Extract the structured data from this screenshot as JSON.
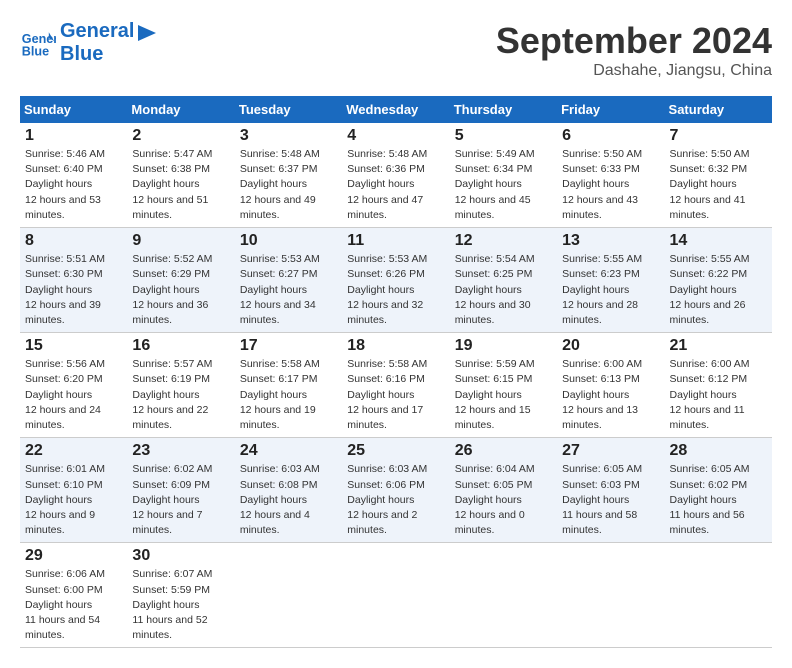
{
  "header": {
    "logo_line1": "General",
    "logo_line2": "Blue",
    "month_title": "September 2024",
    "location": "Dashahe, Jiangsu, China"
  },
  "weekdays": [
    "Sunday",
    "Monday",
    "Tuesday",
    "Wednesday",
    "Thursday",
    "Friday",
    "Saturday"
  ],
  "weeks": [
    [
      {
        "day": "1",
        "sunrise": "5:46 AM",
        "sunset": "6:40 PM",
        "daylight": "12 hours and 53 minutes."
      },
      {
        "day": "2",
        "sunrise": "5:47 AM",
        "sunset": "6:38 PM",
        "daylight": "12 hours and 51 minutes."
      },
      {
        "day": "3",
        "sunrise": "5:48 AM",
        "sunset": "6:37 PM",
        "daylight": "12 hours and 49 minutes."
      },
      {
        "day": "4",
        "sunrise": "5:48 AM",
        "sunset": "6:36 PM",
        "daylight": "12 hours and 47 minutes."
      },
      {
        "day": "5",
        "sunrise": "5:49 AM",
        "sunset": "6:34 PM",
        "daylight": "12 hours and 45 minutes."
      },
      {
        "day": "6",
        "sunrise": "5:50 AM",
        "sunset": "6:33 PM",
        "daylight": "12 hours and 43 minutes."
      },
      {
        "day": "7",
        "sunrise": "5:50 AM",
        "sunset": "6:32 PM",
        "daylight": "12 hours and 41 minutes."
      }
    ],
    [
      {
        "day": "8",
        "sunrise": "5:51 AM",
        "sunset": "6:30 PM",
        "daylight": "12 hours and 39 minutes."
      },
      {
        "day": "9",
        "sunrise": "5:52 AM",
        "sunset": "6:29 PM",
        "daylight": "12 hours and 36 minutes."
      },
      {
        "day": "10",
        "sunrise": "5:53 AM",
        "sunset": "6:27 PM",
        "daylight": "12 hours and 34 minutes."
      },
      {
        "day": "11",
        "sunrise": "5:53 AM",
        "sunset": "6:26 PM",
        "daylight": "12 hours and 32 minutes."
      },
      {
        "day": "12",
        "sunrise": "5:54 AM",
        "sunset": "6:25 PM",
        "daylight": "12 hours and 30 minutes."
      },
      {
        "day": "13",
        "sunrise": "5:55 AM",
        "sunset": "6:23 PM",
        "daylight": "12 hours and 28 minutes."
      },
      {
        "day": "14",
        "sunrise": "5:55 AM",
        "sunset": "6:22 PM",
        "daylight": "12 hours and 26 minutes."
      }
    ],
    [
      {
        "day": "15",
        "sunrise": "5:56 AM",
        "sunset": "6:20 PM",
        "daylight": "12 hours and 24 minutes."
      },
      {
        "day": "16",
        "sunrise": "5:57 AM",
        "sunset": "6:19 PM",
        "daylight": "12 hours and 22 minutes."
      },
      {
        "day": "17",
        "sunrise": "5:58 AM",
        "sunset": "6:17 PM",
        "daylight": "12 hours and 19 minutes."
      },
      {
        "day": "18",
        "sunrise": "5:58 AM",
        "sunset": "6:16 PM",
        "daylight": "12 hours and 17 minutes."
      },
      {
        "day": "19",
        "sunrise": "5:59 AM",
        "sunset": "6:15 PM",
        "daylight": "12 hours and 15 minutes."
      },
      {
        "day": "20",
        "sunrise": "6:00 AM",
        "sunset": "6:13 PM",
        "daylight": "12 hours and 13 minutes."
      },
      {
        "day": "21",
        "sunrise": "6:00 AM",
        "sunset": "6:12 PM",
        "daylight": "12 hours and 11 minutes."
      }
    ],
    [
      {
        "day": "22",
        "sunrise": "6:01 AM",
        "sunset": "6:10 PM",
        "daylight": "12 hours and 9 minutes."
      },
      {
        "day": "23",
        "sunrise": "6:02 AM",
        "sunset": "6:09 PM",
        "daylight": "12 hours and 7 minutes."
      },
      {
        "day": "24",
        "sunrise": "6:03 AM",
        "sunset": "6:08 PM",
        "daylight": "12 hours and 4 minutes."
      },
      {
        "day": "25",
        "sunrise": "6:03 AM",
        "sunset": "6:06 PM",
        "daylight": "12 hours and 2 minutes."
      },
      {
        "day": "26",
        "sunrise": "6:04 AM",
        "sunset": "6:05 PM",
        "daylight": "12 hours and 0 minutes."
      },
      {
        "day": "27",
        "sunrise": "6:05 AM",
        "sunset": "6:03 PM",
        "daylight": "11 hours and 58 minutes."
      },
      {
        "day": "28",
        "sunrise": "6:05 AM",
        "sunset": "6:02 PM",
        "daylight": "11 hours and 56 minutes."
      }
    ],
    [
      {
        "day": "29",
        "sunrise": "6:06 AM",
        "sunset": "6:00 PM",
        "daylight": "11 hours and 54 minutes."
      },
      {
        "day": "30",
        "sunrise": "6:07 AM",
        "sunset": "5:59 PM",
        "daylight": "11 hours and 52 minutes."
      },
      null,
      null,
      null,
      null,
      null
    ]
  ]
}
